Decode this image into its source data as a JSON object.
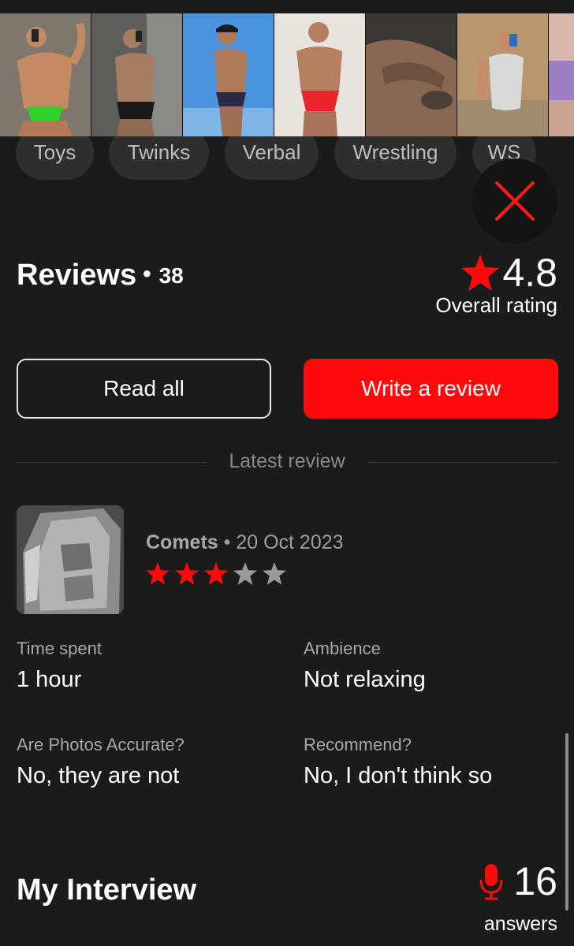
{
  "photos": [
    {
      "name": "photo-1",
      "bg": "#8d8579",
      "skin": "#c48a63",
      "accent": "#2fd12b"
    },
    {
      "name": "photo-2",
      "bg": "#6f6e6b",
      "skin": "#a77d62",
      "accent": "#1a1a1a"
    },
    {
      "name": "photo-3",
      "bg": "#3f89d6",
      "skin": "#b07a5a",
      "accent": "#2b2b45"
    },
    {
      "name": "photo-4",
      "bg": "#ece7e1",
      "skin": "#b67f61",
      "accent": "#e8252a"
    },
    {
      "name": "photo-5",
      "bg": "#2c2a28",
      "skin": "#8a6752",
      "accent": "#4a4038"
    },
    {
      "name": "photo-6",
      "bg": "#c2a47f",
      "skin": "#c58c6a",
      "accent": "#d9d9d9"
    },
    {
      "name": "photo-7",
      "bg": "#e3c2b8",
      "skin": "#c9a392",
      "accent": "#9c7ec2"
    }
  ],
  "tags": [
    "Toys",
    "Twinks",
    "Verbal",
    "Wrestling",
    "WS"
  ],
  "reviews": {
    "title": "Reviews",
    "dot": "•",
    "count": "38",
    "rating": "4.8",
    "rating_label": "Overall rating",
    "read_all": "Read all",
    "write_review": "Write a review",
    "latest_label": "Latest review"
  },
  "latest_review": {
    "reviewer": "Comets",
    "separator": " • ",
    "date": "20 Oct 2023",
    "stars_filled": 3,
    "stars_total": 5,
    "fields": [
      {
        "label": "Time spent",
        "value": "1 hour"
      },
      {
        "label": "Ambience",
        "value": "Not relaxing"
      },
      {
        "label": "Are Photos Accurate?",
        "value": "No, they are not"
      },
      {
        "label": "Recommend?",
        "value": "No, I don't think so"
      }
    ]
  },
  "interview": {
    "title": "My Interview",
    "answers_count": "16",
    "answers_label": "answers"
  },
  "colors": {
    "accent_red": "#ff0a0a",
    "star_inactive": "#9a9a9a",
    "background": "#1b1b1b"
  }
}
